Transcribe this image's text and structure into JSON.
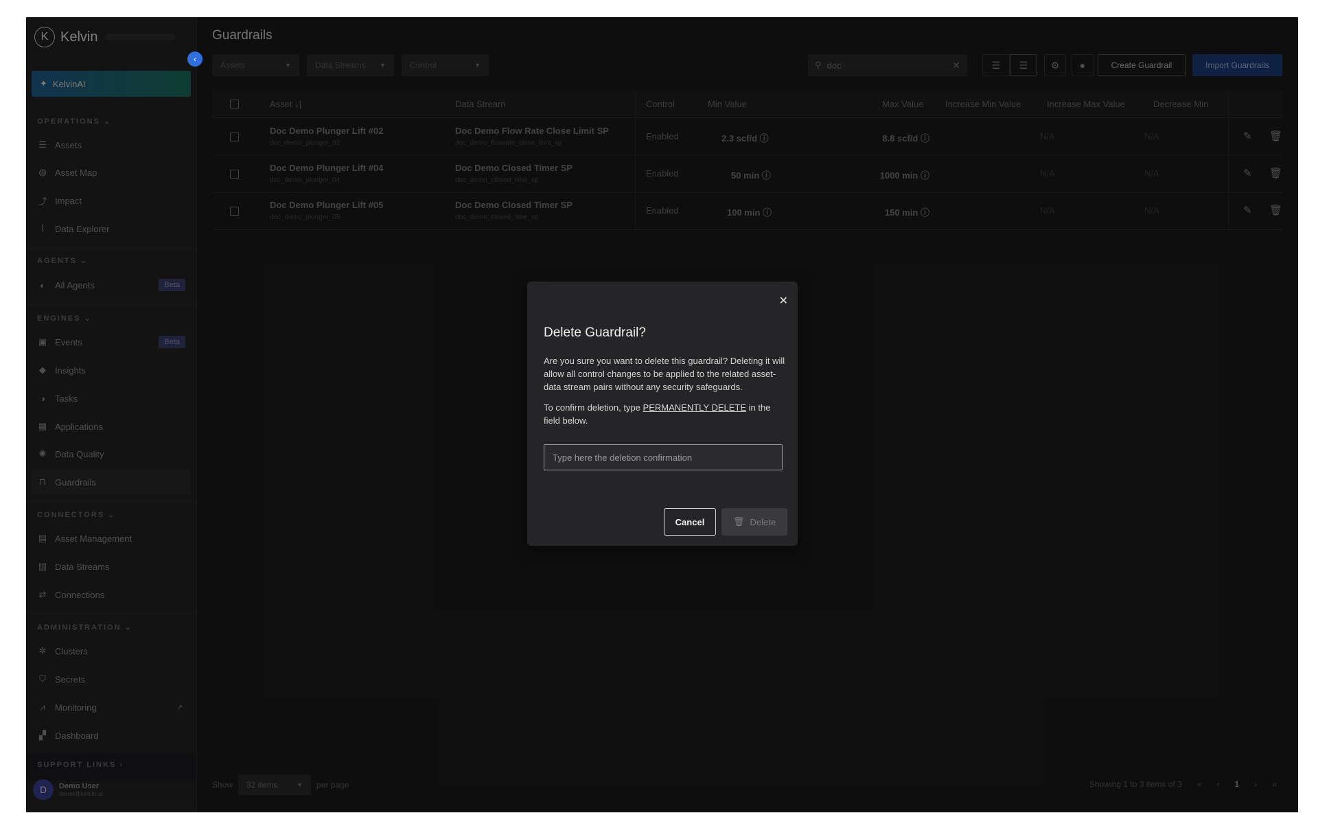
{
  "app": {
    "name": "Kelvin"
  },
  "sidebar": {
    "ai_label": "KelvinAI",
    "sections": {
      "operations": "OPERATIONS",
      "agents": "AGENTS",
      "engines": "ENGINES",
      "connectors": "CONNECTORS",
      "administration": "ADMINISTRATION",
      "support": "SUPPORT LINKS"
    },
    "items": {
      "assets": "Assets",
      "asset_map": "Asset Map",
      "impact": "Impact",
      "data_explorer": "Data Explorer",
      "all_agents": "All Agents",
      "events": "Events",
      "insights": "Insights",
      "tasks": "Tasks",
      "applications": "Applications",
      "data_quality": "Data Quality",
      "guardrails": "Guardrails",
      "asset_management": "Asset Management",
      "data_streams": "Data Streams",
      "connections": "Connections",
      "clusters": "Clusters",
      "secrets": "Secrets",
      "monitoring": "Monitoring",
      "dashboard": "Dashboard"
    },
    "beta": "Beta",
    "user": {
      "initial": "D",
      "name": "Demo User",
      "email": "demo@kelvin.ai"
    }
  },
  "page": {
    "title": "Guardrails",
    "filters": {
      "assets": "Assets",
      "data_streams": "Data Streams",
      "control": "Control"
    },
    "search": {
      "value": "doc"
    },
    "create_label": "Create Guardrail",
    "import_label": "Import Guardrails"
  },
  "table": {
    "headers": {
      "asset": "Asset ↓|",
      "data_stream": "Data Stream",
      "control": "Control",
      "min": "Min Value",
      "max": "Max Value",
      "inc_min": "Increase Min Value",
      "inc_max": "Increase Max Value",
      "dec_min": "Decrease Min"
    },
    "rows": [
      {
        "asset": "Doc Demo Plunger Lift #02",
        "asset_id": "doc_demo_plunger_02",
        "stream": "Doc Demo Flow Rate Close Limit SP",
        "stream_id": "doc_demo_flowrate_close_limit_sp",
        "control": "Enabled",
        "min": "2.3 scf/d",
        "max": "8.8 scf/d",
        "inc_min": "N/A",
        "inc_max": "N/A"
      },
      {
        "asset": "Doc Demo Plunger Lift #04",
        "asset_id": "doc_demo_plunger_04",
        "stream": "Doc Demo Closed Timer SP",
        "stream_id": "doc_demo_closed_time_sp",
        "control": "Enabled",
        "min": "50 min",
        "max": "1000 min",
        "inc_min": "N/A",
        "inc_max": "N/A"
      },
      {
        "asset": "Doc Demo Plunger Lift #05",
        "asset_id": "doc_demo_plunger_05",
        "stream": "Doc Demo Closed Timer SP",
        "stream_id": "doc_demo_closed_time_sp",
        "control": "Enabled",
        "min": "100 min",
        "max": "150 min",
        "inc_min": "N/A",
        "inc_max": "N/A"
      }
    ]
  },
  "footer": {
    "show": "Show",
    "per_page_value": "32 items",
    "per_page": "per page",
    "showing": "Showing 1 to 3 items of 3",
    "page": "1"
  },
  "modal": {
    "title": "Delete Guardrail?",
    "body": "Are you sure you want to delete this guardrail? Deleting it will allow all control changes to be applied to the related asset-data stream pairs without any security safeguards.",
    "confirm_prefix": "To confirm deletion, type",
    "confirm_keyword": "PERMANENTLY DELETE",
    "confirm_suffix": "in the field below.",
    "input_placeholder": "Type here the deletion confirmation",
    "cancel": "Cancel",
    "delete": "Delete"
  }
}
